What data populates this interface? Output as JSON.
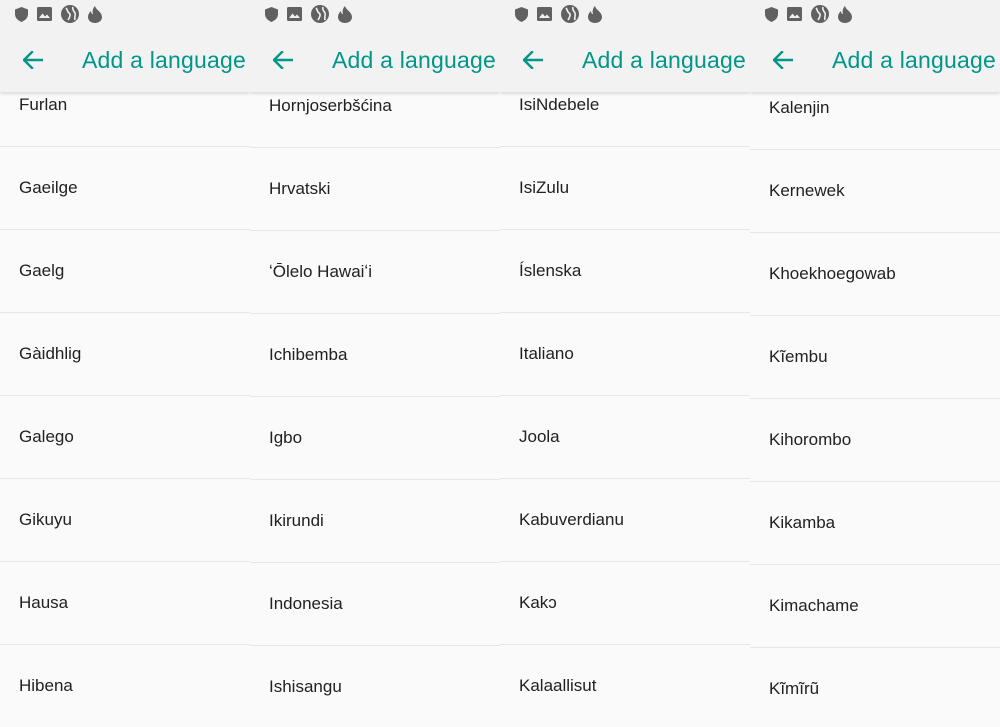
{
  "toolbar": {
    "title": "Add a language"
  },
  "icons": {
    "status": [
      "shield-icon",
      "image-icon",
      "globe-icon",
      "flame-icon"
    ],
    "back": "arrow-back-icon"
  },
  "colors": {
    "accent": "#009688",
    "text": "#212121",
    "divider": "#e6e6e6",
    "background": "#fafafa"
  },
  "screens": [
    {
      "languages": [
        "Furlan",
        "Gaeilge",
        "Gaelg",
        "Gàidhlig",
        "Galego",
        "Gikuyu",
        "Hausa",
        "Hibena"
      ]
    },
    {
      "languages": [
        "Hornjoserbšćina",
        "Hrvatski",
        "ʻŌlelo Hawaiʻi",
        "Ichibemba",
        "Igbo",
        "Ikirundi",
        "Indonesia",
        "Ishisangu"
      ]
    },
    {
      "languages": [
        "IsiNdebele",
        "IsiZulu",
        "Íslenska",
        "Italiano",
        "Joola",
        "Kabuverdianu",
        "Kakɔ",
        "Kalaallisut"
      ]
    },
    {
      "languages": [
        "Kalenjin",
        "Kernewek",
        "Khoekhoegowab",
        "Kĩembu",
        "Kihorombo",
        "Kikamba",
        "Kimachame",
        "Kĩmĩrũ"
      ]
    }
  ]
}
